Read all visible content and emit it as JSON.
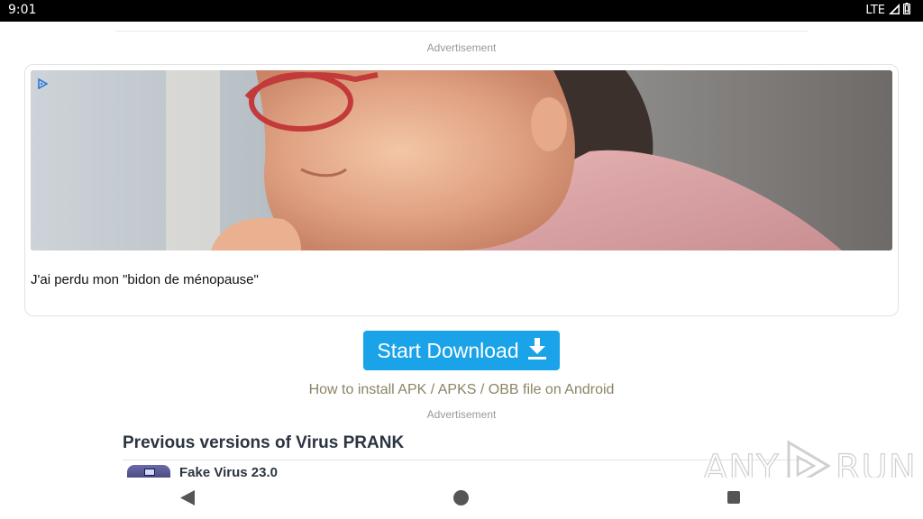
{
  "status_bar": {
    "time": "9:01",
    "network": "LTE"
  },
  "ads": {
    "top_label": "Advertisement",
    "card_caption": "J'ai perdu mon \"bidon de ménopause\"",
    "bottom_label": "Advertisement"
  },
  "download": {
    "button_label": "Start Download"
  },
  "install_link": "How to install APK / APKS / OBB file on Android",
  "previous_versions": {
    "title": "Previous versions of Virus PRANK",
    "items": [
      {
        "name": "Fake Virus 23.0"
      }
    ]
  },
  "watermark": {
    "left": "ANY",
    "right": "RUN"
  },
  "colors": {
    "accent": "#1aa3e8",
    "link": "#8b8464",
    "heading": "#2b3440",
    "status_bar": "#000000"
  },
  "icons": [
    "signal-icon",
    "battery-icon",
    "adchoices-icon",
    "download-icon",
    "back-icon",
    "home-icon",
    "recents-icon"
  ]
}
